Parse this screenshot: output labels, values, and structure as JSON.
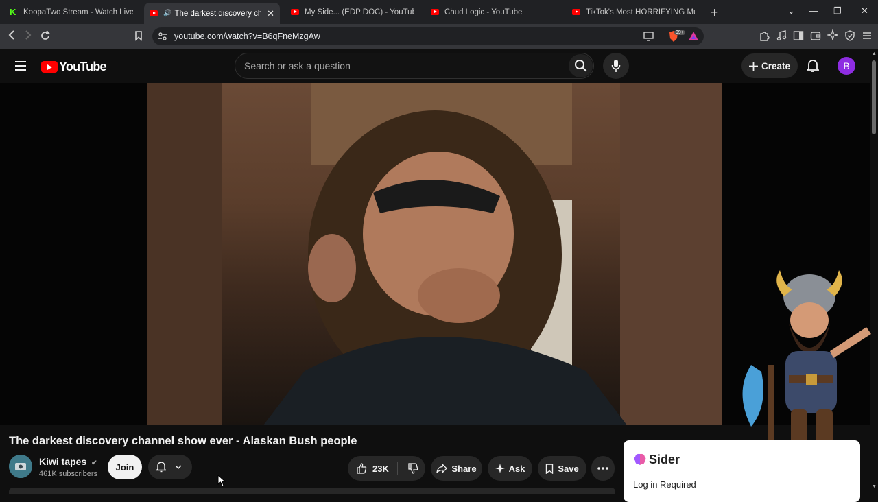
{
  "browser": {
    "tabs": [
      {
        "title": "KoopaTwo Stream - Watch Live on Ki",
        "icon": "kick-icon"
      },
      {
        "title": "The darkest discovery channe",
        "icon": "youtube-icon",
        "active": true
      },
      {
        "title": "My Side... (EDP DOC) - YouTube",
        "icon": "youtube-icon"
      },
      {
        "title": "Chud Logic - YouTube",
        "icon": "youtube-icon"
      },
      {
        "title": "TikTok's Most HORRIFYING Mukbang",
        "icon": "youtube-icon"
      }
    ],
    "url": "youtube.com/watch?v=B6qFneMzgAw",
    "brave_badge": "99+"
  },
  "youtube": {
    "logo_text": "YouTube",
    "search_placeholder": "Search or ask a question",
    "create_label": "Create",
    "avatar_letter": "B"
  },
  "video": {
    "title": "The darkest discovery channel show ever - Alaskan Bush people",
    "channel_name": "Kiwi tapes",
    "subscribers": "461K subscribers",
    "join_label": "Join",
    "likes": "23K",
    "share_label": "Share",
    "ask_label": "Ask",
    "save_label": "Save"
  },
  "sider": {
    "name": "Sider",
    "login_text": "Log in Required"
  },
  "colors": {
    "youtube_red": "#ff0000",
    "avatar_purple": "#8e2de2",
    "background": "#0f0f0f"
  }
}
